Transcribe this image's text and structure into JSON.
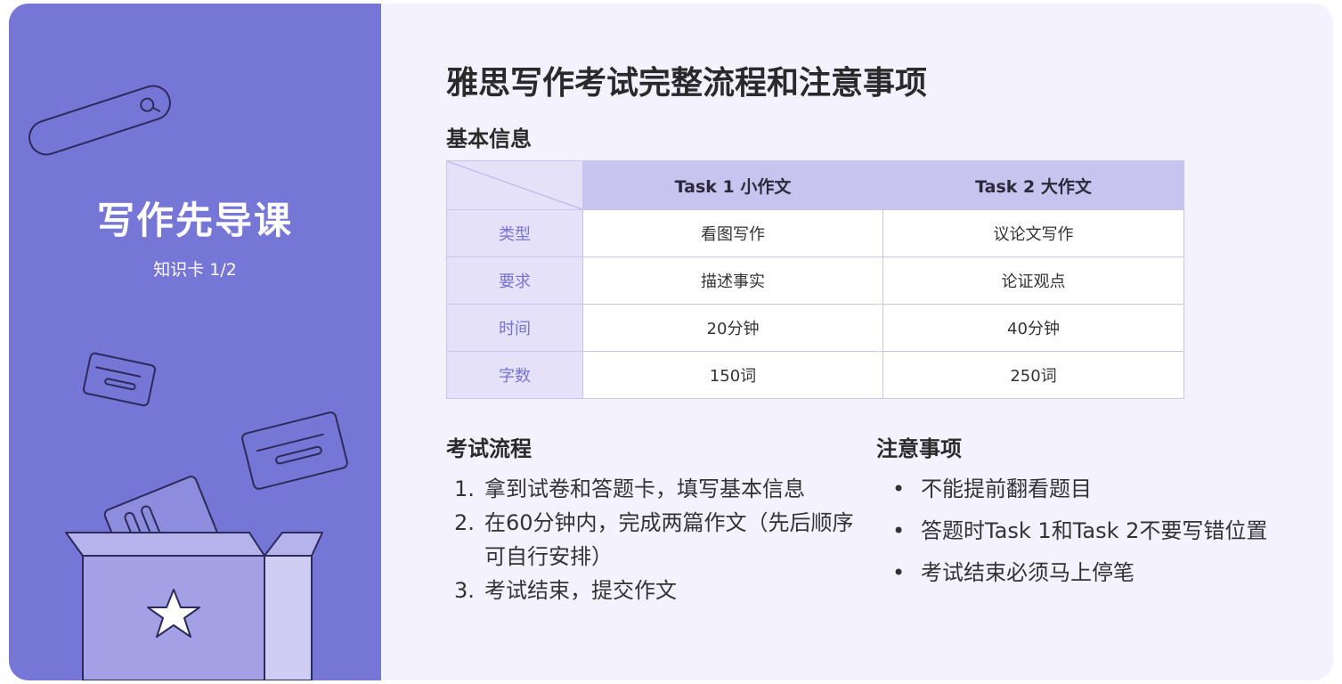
{
  "sidebar": {
    "title": "写作先导课",
    "subtitle": "知识卡 1/2"
  },
  "main": {
    "title": "雅思写作考试完整流程和注意事项",
    "basic_info": {
      "heading": "基本信息",
      "columns": [
        "Task 1 小作文",
        "Task 2 大作文"
      ],
      "rows": [
        {
          "label": "类型",
          "task1": "看图写作",
          "task2": "议论文写作"
        },
        {
          "label": "要求",
          "task1": "描述事实",
          "task2": "论证观点"
        },
        {
          "label": "时间",
          "task1": "20分钟",
          "task2": "40分钟"
        },
        {
          "label": "字数",
          "task1": "150词",
          "task2": "250词"
        }
      ]
    },
    "process": {
      "heading": "考试流程",
      "items": [
        {
          "num": "1.",
          "text": "拿到试卷和答题卡，填写基本信息"
        },
        {
          "num": "2.",
          "text": "在60分钟内，完成两篇作文（先后顺序可自行安排）"
        },
        {
          "num": "3.",
          "text": "考试结束，提交作文"
        }
      ]
    },
    "notes": {
      "heading": "注意事项",
      "bullet": "•",
      "items": [
        "不能提前翻看题目",
        "答题时Task 1和Task 2不要写错位置",
        "考试结束必须马上停笔"
      ]
    }
  },
  "colors": {
    "sidebar_bg": "#7676d6",
    "page_bg": "#f3f2fe",
    "table_header": "#c7c4ef",
    "table_row_header": "#e4e1f8",
    "row_label_text": "#7a74d0"
  },
  "icons": [
    "search-bar-icon",
    "card-icon",
    "open-box-icon",
    "star-icon"
  ]
}
